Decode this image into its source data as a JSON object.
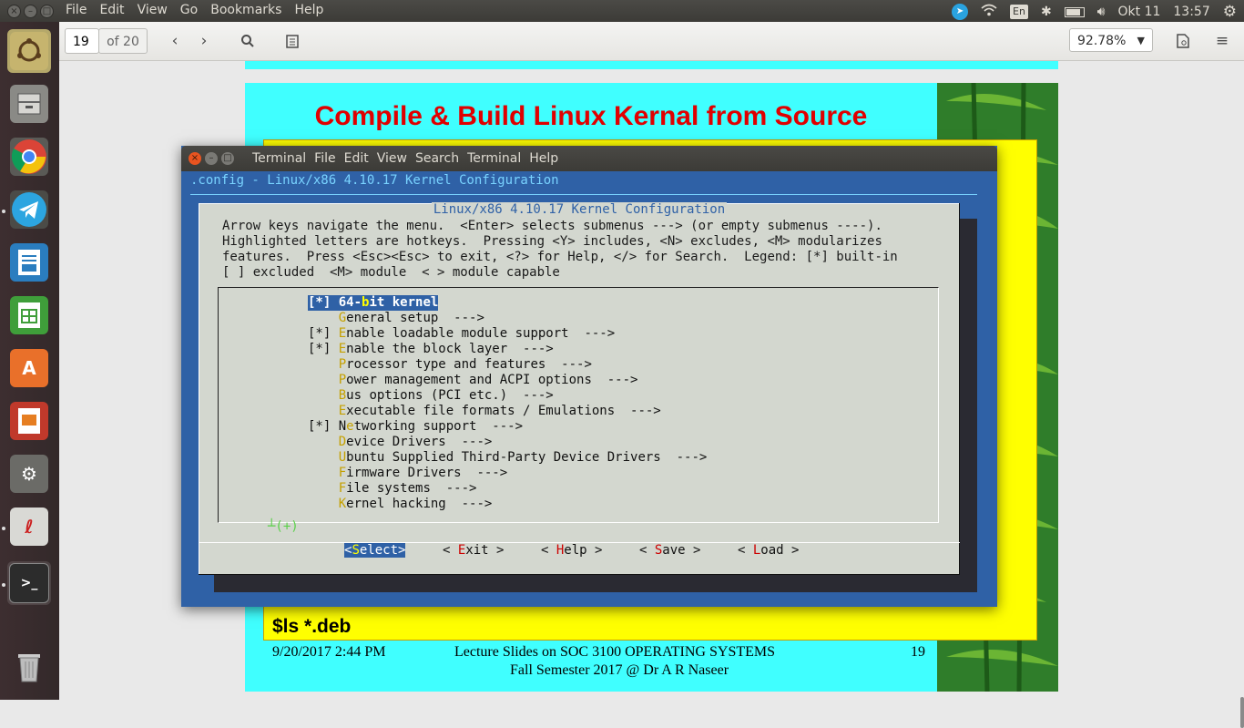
{
  "top_panel": {
    "menus": [
      "File",
      "Edit",
      "View",
      "Go",
      "Bookmarks",
      "Help"
    ],
    "keyboard_layout": "En",
    "date": "Okt 11",
    "time": "13:57"
  },
  "viewer_toolbar": {
    "page_current": "19",
    "page_total": "of 20",
    "zoom": "92.78%"
  },
  "launcher": {
    "apps": [
      "ubuntu-dash",
      "files",
      "chrome",
      "telegram",
      "libreoffice-writer",
      "libreoffice-calc",
      "software-center",
      "libreoffice-impress",
      "system-settings",
      "pdf-viewer",
      "terminal",
      "trash"
    ]
  },
  "slide": {
    "title": "Compile & Build Linux Kernal from Source",
    "command": "$ls  *.deb",
    "footer_date": "9/20/2017 2:44 PM",
    "footer_line1": "Lecture Slides on SOC 3100 OPERATING SYSTEMS",
    "footer_line2": "Fall Semester 2017 @ Dr A R Naseer",
    "footer_page": "19"
  },
  "terminal": {
    "menus": [
      "Terminal",
      "File",
      "Edit",
      "View",
      "Search",
      "Terminal",
      "Help"
    ],
    "config_header": ".config - Linux/x86 4.10.17 Kernel Configuration",
    "dialog_title": "Linux/x86 4.10.17 Kernel Configuration",
    "help_lines": [
      "Arrow keys navigate the menu.  <Enter> selects submenus ---> (or empty submenus ----).",
      "Highlighted letters are hotkeys.  Pressing <Y> includes, <N> excludes, <M> modularizes",
      "features.  Press <Esc><Esc> to exit, <?> for Help, </> for Search.  Legend: [*] built-in",
      "[ ] excluded  <M> module  < > module capable"
    ],
    "menu_items": [
      {
        "prefix": "[*]",
        "hk": "",
        "pre": "64-",
        "hkchar": "b",
        "rest": "it kernel",
        "selected": true
      },
      {
        "prefix": "   ",
        "pre": "",
        "hkchar": "G",
        "rest": "eneral setup  --->",
        "selected": false
      },
      {
        "prefix": "[*]",
        "pre": "",
        "hkchar": "E",
        "rest": "nable loadable module support  --->",
        "selected": false
      },
      {
        "prefix": "[*]",
        "pre": "",
        "hkchar": "E",
        "rest": "nable the block layer  --->",
        "selected": false
      },
      {
        "prefix": "   ",
        "pre": "",
        "hkchar": "P",
        "rest": "rocessor type and features  --->",
        "selected": false
      },
      {
        "prefix": "   ",
        "pre": "",
        "hkchar": "P",
        "rest": "ower management and ACPI options  --->",
        "selected": false
      },
      {
        "prefix": "   ",
        "pre": "",
        "hkchar": "B",
        "rest": "us options (PCI etc.)  --->",
        "selected": false
      },
      {
        "prefix": "   ",
        "pre": "",
        "hkchar": "E",
        "rest": "xecutable file formats / Emulations  --->",
        "selected": false
      },
      {
        "prefix": "[*]",
        "pre": "N",
        "hkchar": "e",
        "rest": "tworking support  --->",
        "selected": false
      },
      {
        "prefix": "   ",
        "pre": "",
        "hkchar": "D",
        "rest": "evice Drivers  --->",
        "selected": false
      },
      {
        "prefix": "   ",
        "pre": "",
        "hkchar": "U",
        "rest": "buntu Supplied Third-Party Device Drivers  --->",
        "selected": false
      },
      {
        "prefix": "   ",
        "pre": "",
        "hkchar": "F",
        "rest": "irmware Drivers  --->",
        "selected": false
      },
      {
        "prefix": "   ",
        "pre": "",
        "hkchar": "F",
        "rest": "ile systems  --->",
        "selected": false
      },
      {
        "prefix": "   ",
        "pre": "",
        "hkchar": "K",
        "rest": "ernel hacking  --->",
        "selected": false
      }
    ],
    "more_indicator": "┴(+)",
    "buttons": [
      {
        "pre": "<",
        "hk": "S",
        "rest": "elect>",
        "selected": true
      },
      {
        "pre": "< ",
        "hk": "E",
        "rest": "xit >",
        "selected": false
      },
      {
        "pre": "< ",
        "hk": "H",
        "rest": "elp >",
        "selected": false
      },
      {
        "pre": "< ",
        "hk": "S",
        "rest": "ave >",
        "selected": false
      },
      {
        "pre": "< ",
        "hk": "L",
        "rest": "oad >",
        "selected": false
      }
    ]
  }
}
